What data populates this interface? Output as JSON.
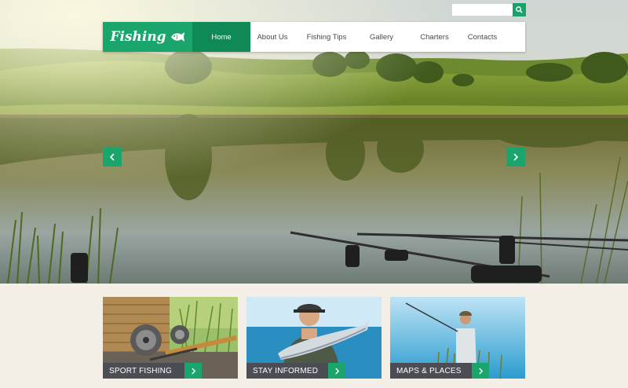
{
  "search": {
    "placeholder": "",
    "value": "",
    "icon": "search-icon"
  },
  "nav": {
    "logo_text": "Fishing",
    "logo_icon": "fish-icon",
    "items": [
      {
        "label": "Home",
        "active": true
      },
      {
        "label": "About Us",
        "active": false
      },
      {
        "label": "Fishing Tips",
        "active": false
      },
      {
        "label": "Gallery",
        "active": false
      },
      {
        "label": "Charters",
        "active": false
      },
      {
        "label": "Contacts",
        "active": false
      }
    ]
  },
  "slider": {
    "prev_icon": "chevron-left-icon",
    "next_icon": "chevron-right-icon"
  },
  "cards": [
    {
      "label": "SPORT FISHING",
      "icon": "chevron-right-icon"
    },
    {
      "label": "STAY INFORMED",
      "icon": "chevron-right-icon"
    },
    {
      "label": "MAPS & PLACES",
      "icon": "chevron-right-icon"
    }
  ],
  "colors": {
    "accent": "#1aa56c",
    "accent_dark": "#0f8a57",
    "card_bar": "#4a4d54",
    "page_bg": "#f3efe6"
  }
}
